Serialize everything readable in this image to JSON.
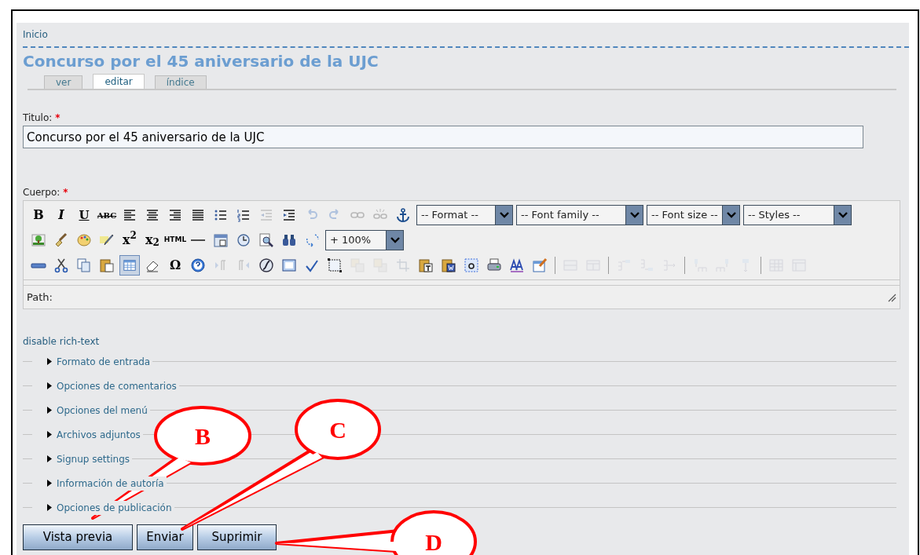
{
  "breadcrumb": "Inicio",
  "page_title": "Concurso por el 45 aniversario de la UJC",
  "tabs": [
    {
      "label": "ver",
      "selected": false
    },
    {
      "label": "editar",
      "selected": true
    },
    {
      "label": "índice",
      "selected": false
    }
  ],
  "title_field": {
    "label": "Titulo:",
    "required_mark": "*",
    "value": "Concurso por el 45 aniversario de la UJC"
  },
  "body_field": {
    "label": "Cuerpo:",
    "required_mark": "*"
  },
  "toolbar_rows": [
    [
      {
        "kind": "glyph",
        "text": "B"
      },
      {
        "kind": "glyph",
        "text": "I"
      },
      {
        "kind": "glyph",
        "text": "U"
      },
      {
        "kind": "glyph",
        "text": "ABC"
      },
      {
        "kind": "button",
        "disabled": false
      },
      {
        "kind": "button",
        "disabled": false
      },
      {
        "kind": "button",
        "disabled": false
      },
      {
        "kind": "button",
        "disabled": false
      },
      {
        "kind": "button",
        "disabled": false
      },
      {
        "kind": "button",
        "disabled": false
      },
      {
        "kind": "button",
        "disabled": true
      },
      {
        "kind": "button",
        "disabled": false
      },
      {
        "kind": "button",
        "disabled": true
      },
      {
        "kind": "button",
        "disabled": true
      },
      {
        "kind": "button",
        "disabled": true
      },
      {
        "kind": "button",
        "disabled": true
      },
      {
        "kind": "button",
        "disabled": false
      },
      {
        "kind": "select",
        "value": "-- Format --"
      },
      {
        "kind": "select",
        "value": "-- Font family --"
      },
      {
        "kind": "select",
        "value": "-- Font size --"
      },
      {
        "kind": "select",
        "value": "-- Styles --"
      }
    ],
    [
      {
        "kind": "button",
        "disabled": false
      },
      {
        "kind": "button",
        "disabled": false
      },
      {
        "kind": "button",
        "disabled": false
      },
      {
        "kind": "button",
        "disabled": false
      },
      {
        "kind": "glyph",
        "text": "x$^{2}$"
      },
      {
        "kind": "glyph",
        "text": "x$_{2}$"
      },
      {
        "kind": "glyph",
        "text": "HTML"
      },
      {
        "kind": "button",
        "disabled": false
      },
      {
        "kind": "button",
        "disabled": false
      },
      {
        "kind": "button",
        "disabled": false
      },
      {
        "kind": "button",
        "disabled": false
      },
      {
        "kind": "button",
        "disabled": false
      },
      {
        "kind": "button",
        "disabled": false
      },
      {
        "kind": "select",
        "value": "+ 100%"
      }
    ],
    [
      {
        "kind": "button",
        "disabled": false
      },
      {
        "kind": "button",
        "disabled": false
      },
      {
        "kind": "button",
        "disabled": false
      },
      {
        "kind": "button",
        "disabled": false
      },
      {
        "kind": "button",
        "disabled": false,
        "selected": true
      },
      {
        "kind": "button",
        "disabled": false
      },
      {
        "kind": "glyph",
        "text": "Ω"
      },
      {
        "kind": "button",
        "disabled": false
      },
      {
        "kind": "button",
        "disabled": true
      },
      {
        "kind": "button",
        "disabled": true
      },
      {
        "kind": "button",
        "disabled": false
      },
      {
        "kind": "button",
        "disabled": false
      },
      {
        "kind": "button",
        "disabled": false
      },
      {
        "kind": "button",
        "disabled": false
      },
      {
        "kind": "button",
        "disabled": true
      },
      {
        "kind": "button",
        "disabled": true
      },
      {
        "kind": "button",
        "disabled": true
      },
      {
        "kind": "button",
        "disabled": false
      },
      {
        "kind": "button",
        "disabled": false
      },
      {
        "kind": "button",
        "disabled": false
      },
      {
        "kind": "button",
        "disabled": false
      },
      {
        "kind": "button",
        "disabled": false
      },
      {
        "kind": "button",
        "disabled": false
      },
      {
        "kind": "separator"
      },
      {
        "kind": "button",
        "disabled": true
      },
      {
        "kind": "button",
        "disabled": true
      },
      {
        "kind": "separator"
      },
      {
        "kind": "button",
        "disabled": true
      },
      {
        "kind": "button",
        "disabled": true
      },
      {
        "kind": "button",
        "disabled": true
      },
      {
        "kind": "separator"
      },
      {
        "kind": "button",
        "disabled": true
      },
      {
        "kind": "button",
        "disabled": true
      },
      {
        "kind": "button",
        "disabled": true
      },
      {
        "kind": "separator"
      },
      {
        "kind": "button",
        "disabled": true
      },
      {
        "kind": "button",
        "disabled": true
      }
    ]
  ],
  "path_label": "Path:",
  "disable_link": "disable rich-text",
  "fieldsets": [
    {
      "legend": "Formato de entrada",
      "expanded": false
    },
    {
      "legend": "Opciones de comentarios",
      "expanded": false
    },
    {
      "legend": "Opciones del menú",
      "expanded": false
    },
    {
      "legend": "Archivos adjuntos",
      "expanded": false
    },
    {
      "legend": "Signup settings",
      "expanded": false
    },
    {
      "legend": "Información de autoría",
      "expanded": false
    },
    {
      "legend": "Opciones de publicación",
      "expanded": false
    }
  ],
  "buttons": [
    "Vista previa",
    "Enviar",
    "Suprimir"
  ],
  "callouts": [
    {
      "label": "B"
    },
    {
      "label": "C"
    },
    {
      "label": "D"
    }
  ]
}
